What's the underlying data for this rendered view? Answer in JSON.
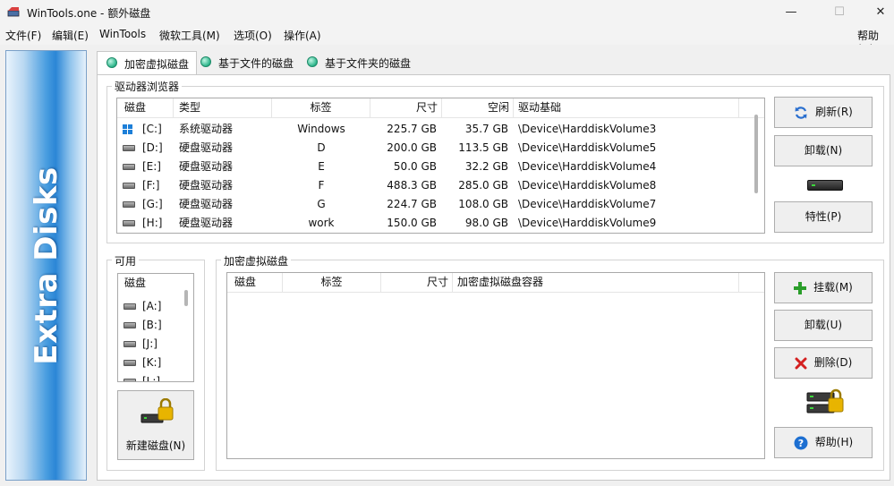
{
  "window": {
    "title": "WinTools.one - 额外磁盘",
    "minimize_glyph": "—",
    "maximize_glyph": "☐",
    "close_glyph": "✕"
  },
  "menubar": {
    "items": [
      "文件(F)",
      "编辑(E)",
      "WinTools",
      "微软工具(M)",
      "选项(O)",
      "操作(A)"
    ],
    "help": "帮助(H)"
  },
  "banner": {
    "text": "Extra Disks"
  },
  "tabs": [
    {
      "label": "加密虚拟磁盘",
      "active": true
    },
    {
      "label": "基于文件的磁盘",
      "active": false
    },
    {
      "label": "基于文件夹的磁盘",
      "active": false
    }
  ],
  "drive_browser": {
    "title": "驱动器浏览器",
    "columns": [
      "磁盘",
      "类型",
      "标签",
      "尺寸",
      "空闲",
      "驱动基础"
    ],
    "rows": [
      {
        "disk": "[C:]",
        "type": "系统驱动器",
        "label": "Windows",
        "size": "225.7 GB",
        "free": "35.7 GB",
        "base": "\\Device\\HarddiskVolume3",
        "icon": "system-drive-icon"
      },
      {
        "disk": "[D:]",
        "type": "硬盘驱动器",
        "label": "D",
        "size": "200.0 GB",
        "free": "113.5 GB",
        "base": "\\Device\\HarddiskVolume5",
        "icon": "hard-drive-icon"
      },
      {
        "disk": "[E:]",
        "type": "硬盘驱动器",
        "label": "E",
        "size": "50.0 GB",
        "free": "32.2 GB",
        "base": "\\Device\\HarddiskVolume4",
        "icon": "hard-drive-icon"
      },
      {
        "disk": "[F:]",
        "type": "硬盘驱动器",
        "label": "F",
        "size": "488.3 GB",
        "free": "285.0 GB",
        "base": "\\Device\\HarddiskVolume8",
        "icon": "hard-drive-icon"
      },
      {
        "disk": "[G:]",
        "type": "硬盘驱动器",
        "label": "G",
        "size": "224.7 GB",
        "free": "108.0 GB",
        "base": "\\Device\\HarddiskVolume7",
        "icon": "hard-drive-icon"
      },
      {
        "disk": "[H:]",
        "type": "硬盘驱动器",
        "label": "work",
        "size": "150.0 GB",
        "free": "98.0 GB",
        "base": "\\Device\\HarddiskVolume9",
        "icon": "hard-drive-icon"
      }
    ],
    "buttons": {
      "refresh": "刷新(R)",
      "unmount": "卸载(N)",
      "properties": "特性(P)"
    }
  },
  "available": {
    "title": "可用",
    "column": "磁盘",
    "items": [
      "[A:]",
      "[B:]",
      "[J:]",
      "[K:]",
      "[L:]"
    ],
    "new_disk_button": "新建磁盘(N)"
  },
  "encrypted": {
    "title": "加密虚拟磁盘",
    "columns": [
      "磁盘",
      "标签",
      "尺寸",
      "加密虚拟磁盘容器"
    ],
    "buttons": {
      "mount": "挂载(M)",
      "unmount": "卸载(U)",
      "delete": "删除(D)",
      "help": "帮助(H)"
    }
  },
  "colors": {
    "accent_blue": "#2b86d6",
    "add_green": "#2a9d2a",
    "delete_red": "#d42020",
    "lock_gold": "#e8b400"
  }
}
